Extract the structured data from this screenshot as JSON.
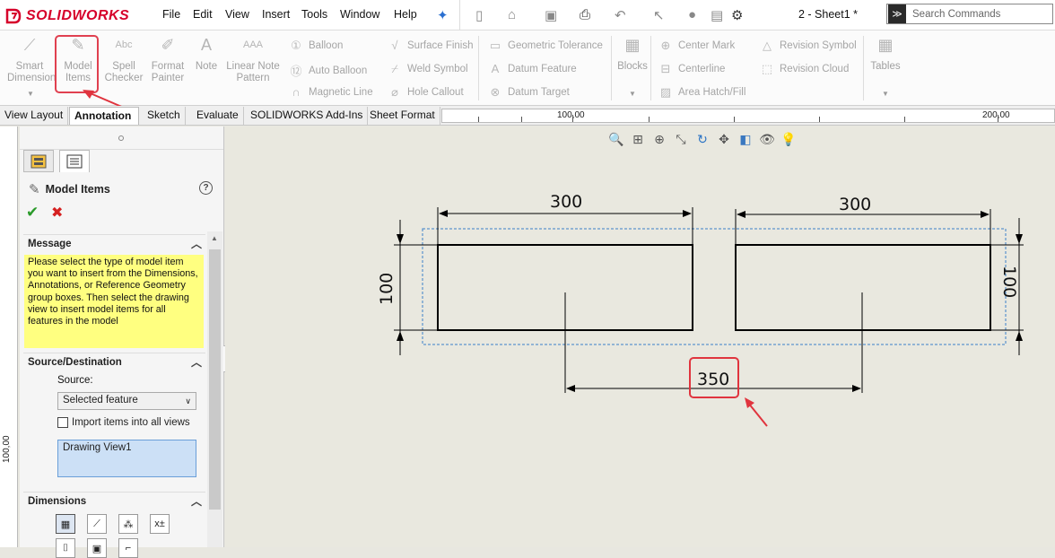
{
  "app": {
    "logo_text": "SOLIDWORKS",
    "document_title": "2 - Sheet1 *"
  },
  "menu": [
    "File",
    "Edit",
    "View",
    "Insert",
    "Tools",
    "Window",
    "Help"
  ],
  "search": {
    "placeholder": "Search Commands"
  },
  "ribbon": {
    "smart_dimension": [
      "Smart",
      "Dimension"
    ],
    "model_items": [
      "Model",
      "Items"
    ],
    "spell_checker": [
      "Spell",
      "Checker"
    ],
    "format_painter": [
      "Format",
      "Painter"
    ],
    "note": "Note",
    "linear_note_pattern": [
      "Linear Note",
      "Pattern"
    ],
    "balloon": "Balloon",
    "auto_balloon": "Auto Balloon",
    "magnetic_line": "Magnetic Line",
    "surface_finish": "Surface Finish",
    "weld_symbol": "Weld Symbol",
    "hole_callout": "Hole Callout",
    "geometric_tolerance": "Geometric Tolerance",
    "datum_feature": "Datum Feature",
    "datum_target": "Datum Target",
    "blocks": "Blocks",
    "center_mark": "Center Mark",
    "centerline": "Centerline",
    "area_hatch": "Area Hatch/Fill",
    "revision_symbol": "Revision Symbol",
    "revision_cloud": "Revision Cloud",
    "tables": "Tables"
  },
  "tabs": [
    {
      "label": "View Layout"
    },
    {
      "label": "Annotation"
    },
    {
      "label": "Sketch"
    },
    {
      "label": "Evaluate"
    },
    {
      "label": "SOLIDWORKS Add-Ins"
    },
    {
      "label": "Sheet Format"
    }
  ],
  "ruler": {
    "top_labels": [
      "100,00",
      "200,00"
    ],
    "left_label": "100,00"
  },
  "property_manager": {
    "title": "Model Items",
    "message_header": "Message",
    "message": "Please select the type of model item you want to insert from the Dimensions, Annotations, or Reference Geometry group boxes. Then select the drawing view  to insert model items for all features in the model",
    "source_header": "Source/Destination",
    "source_label": "Source:",
    "source_value": "Selected feature",
    "import_all_label": "Import items into all views",
    "destination_value": "Drawing View1",
    "dimensions_header": "Dimensions"
  },
  "drawing": {
    "dim_top_left": "300",
    "dim_top_right": "300",
    "dim_left": "100",
    "dim_right": "100",
    "dim_bottom": "350"
  }
}
